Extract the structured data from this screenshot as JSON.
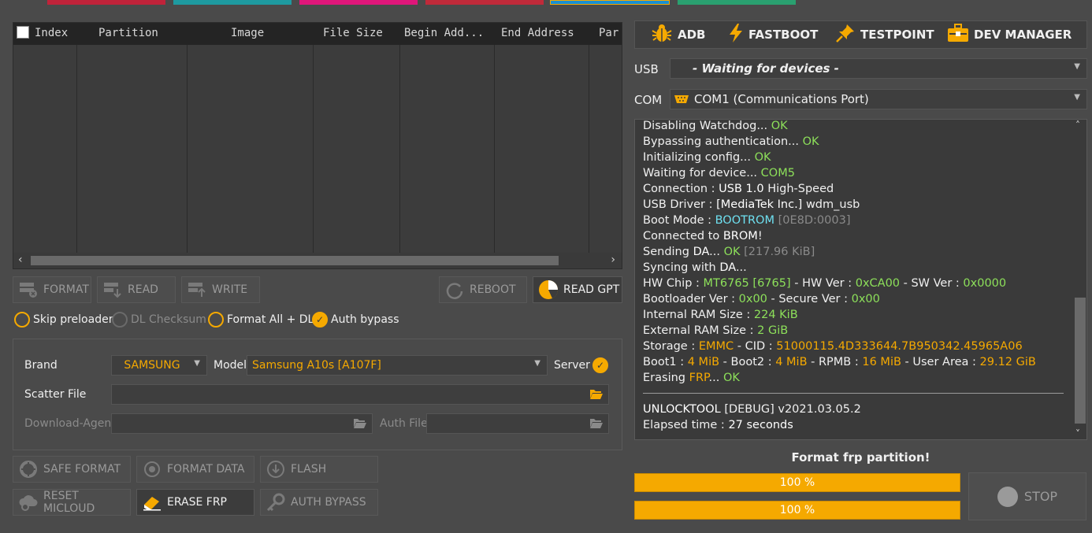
{
  "top_tabs": [
    {
      "color": "#c0233a"
    },
    {
      "color": "#1e9aa0"
    },
    {
      "color": "#e0167a"
    },
    {
      "color": "#c02a3a"
    },
    {
      "color": "#1a8fd0"
    },
    {
      "color": "#2aa070"
    }
  ],
  "table": {
    "columns": [
      "Index",
      "Partition",
      "Image",
      "File Size",
      "Begin Add...",
      "End Address",
      "Par"
    ],
    "select_all_checked": false
  },
  "buttons": {
    "format": "FORMAT",
    "read": "READ",
    "write": "WRITE",
    "reboot": "REBOOT",
    "read_gpt": "READ GPT",
    "safe_format": "SAFE FORMAT",
    "format_data": "FORMAT DATA",
    "flash": "FLASH",
    "reset_micloud": "RESET MICLOUD",
    "erase_frp": "ERASE FRP",
    "auth_bypass": "AUTH BYPASS",
    "stop": "STOP"
  },
  "options": {
    "skip_preloader": {
      "label": "Skip preloader",
      "checked": false
    },
    "dl_checksum": {
      "label": "DL Checksum",
      "checked": false
    },
    "format_all_dl": {
      "label": "Format All + DL",
      "checked": false
    },
    "auth_bypass": {
      "label": "Auth bypass",
      "checked": true
    }
  },
  "panel": {
    "brand_label": "Brand",
    "brand_value": "SAMSUNG",
    "model_label": "Model",
    "model_value": "Samsung A10s [A107F]",
    "server_label": "Server",
    "server_checked": true,
    "scatter_label": "Scatter File",
    "scatter_value": "",
    "da_label": "Download-Agent",
    "da_value": "",
    "auth_label": "Auth File",
    "auth_value": ""
  },
  "right_tabs": [
    "ADB",
    "FASTBOOT",
    "TESTPOINT",
    "DEV MANAGER"
  ],
  "usb": {
    "label": "USB",
    "value": "- Waiting for devices -"
  },
  "com": {
    "label": "COM",
    "value": "COM1 (Communications Port)"
  },
  "log": [
    [
      {
        "t": "Disabling Watchdog... "
      },
      {
        "t": "OK",
        "c": "g"
      }
    ],
    [
      {
        "t": "Bypassing authentication... "
      },
      {
        "t": "OK",
        "c": "g"
      }
    ],
    [
      {
        "t": "Initializing config... "
      },
      {
        "t": "OK",
        "c": "g"
      }
    ],
    [
      {
        "t": "Waiting for device... "
      },
      {
        "t": "COM5",
        "c": "g"
      }
    ],
    [
      {
        "t": "Connection : "
      },
      {
        "t": "USB 1.0",
        "c": "w"
      },
      {
        "t": " High-Speed"
      }
    ],
    [
      {
        "t": "USB Driver : "
      },
      {
        "t": "[MediaTek Inc.]",
        "c": "w"
      },
      {
        "t": " wdm_usb"
      }
    ],
    [
      {
        "t": "Boot Mode : "
      },
      {
        "t": "BOOTROM",
        "c": "c"
      },
      {
        "t": " [0E8D:0003]",
        "c": "d"
      }
    ],
    [
      {
        "t": "Connected to "
      },
      {
        "t": "BROM",
        "c": "w"
      },
      {
        "t": "!"
      }
    ],
    [
      {
        "t": "Sending "
      },
      {
        "t": "DA",
        "c": "w"
      },
      {
        "t": "... "
      },
      {
        "t": "OK",
        "c": "g"
      },
      {
        "t": " [217.96 KiB]",
        "c": "d"
      }
    ],
    [
      {
        "t": "Syncing with "
      },
      {
        "t": "DA",
        "c": "w"
      },
      {
        "t": "..."
      }
    ],
    [
      {
        "t": "HW Chip : "
      },
      {
        "t": "MT6765",
        "c": "g"
      },
      {
        "t": " [6765]",
        "c": "g"
      },
      {
        "t": " - HW Ver : "
      },
      {
        "t": "0xCA00",
        "c": "g"
      },
      {
        "t": " - SW Ver : "
      },
      {
        "t": "0x0000",
        "c": "g"
      }
    ],
    [
      {
        "t": "Bootloader Ver : "
      },
      {
        "t": "0x00",
        "c": "g"
      },
      {
        "t": " - Secure Ver : "
      },
      {
        "t": "0x00",
        "c": "g"
      }
    ],
    [
      {
        "t": "Internal RAM Size : "
      },
      {
        "t": "224 KiB",
        "c": "g"
      }
    ],
    [
      {
        "t": "External RAM Size : "
      },
      {
        "t": "2 GiB",
        "c": "g"
      }
    ],
    [
      {
        "t": "Storage : "
      },
      {
        "t": "EMMC",
        "c": "o"
      },
      {
        "t": " - CID : "
      },
      {
        "t": "51000115.4D333644.7B950342.45965A06",
        "c": "o"
      }
    ],
    [
      {
        "t": "Boot1 : "
      },
      {
        "t": "4 MiB",
        "c": "o"
      },
      {
        "t": " - Boot2 : "
      },
      {
        "t": "4 MiB",
        "c": "o"
      },
      {
        "t": " - RPMB : "
      },
      {
        "t": "16 MiB",
        "c": "o"
      },
      {
        "t": " - User Area : "
      },
      {
        "t": "29.12 GiB",
        "c": "o"
      }
    ],
    [
      {
        "t": "Erasing "
      },
      {
        "t": "FRP",
        "c": "o"
      },
      {
        "t": "... "
      },
      {
        "t": "OK",
        "c": "g"
      }
    ]
  ],
  "log_footer": [
    [
      {
        "t": "UNLOCKTOOL",
        "c": "w"
      },
      {
        "t": " [DEBUG] v2021.03.05.2"
      }
    ],
    [
      {
        "t": "Elapsed time : "
      },
      {
        "t": "27 seconds",
        "c": "w"
      }
    ]
  ],
  "status_text": "Format frp partition!",
  "progress": [
    {
      "label": "100 %",
      "value": 1.0
    },
    {
      "label": "100 %",
      "value": 1.0
    }
  ],
  "accent_color": "#f5a900"
}
